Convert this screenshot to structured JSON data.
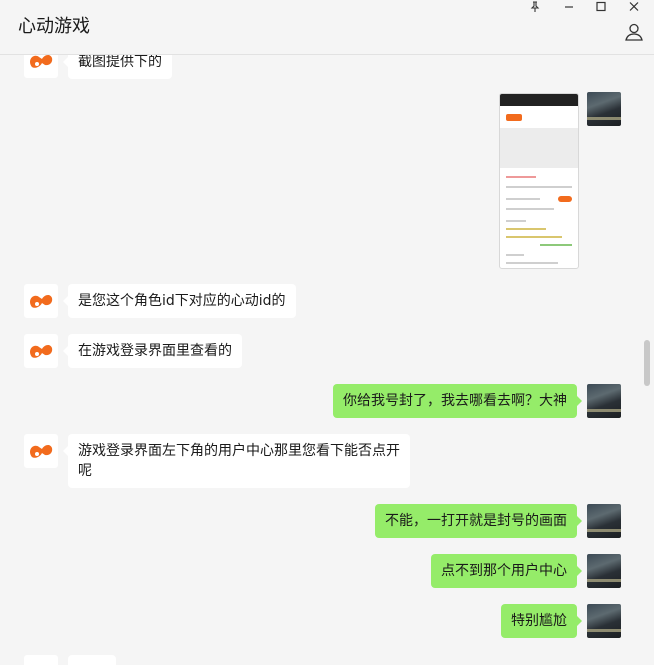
{
  "window": {
    "title": "心动游戏"
  },
  "messages": [
    {
      "side": "left",
      "text": "截图提供下的"
    },
    {
      "side": "right",
      "type": "image"
    },
    {
      "side": "left",
      "text": "是您这个角色id下对应的心动id的"
    },
    {
      "side": "left",
      "text": "在游戏登录界面里查看的"
    },
    {
      "side": "right",
      "text": "你给我号封了，我去哪看去啊？大神"
    },
    {
      "side": "left",
      "text": "游戏登录界面左下角的用户中心那里您看下能否点开呢"
    },
    {
      "side": "right",
      "text": "不能，一打开就是封号的画面"
    },
    {
      "side": "right",
      "text": "点不到那个用户中心"
    },
    {
      "side": "right",
      "text": "特别尴尬"
    }
  ],
  "icons": {
    "pin": "pin-icon",
    "minimize": "minimize-icon",
    "maximize": "maximize-icon",
    "close": "close-icon",
    "profile": "profile-icon",
    "logo": "xd-logo-icon"
  },
  "colors": {
    "bubble_self": "#95ec69",
    "bubble_other": "#ffffff",
    "logo": "#f26b1d"
  }
}
